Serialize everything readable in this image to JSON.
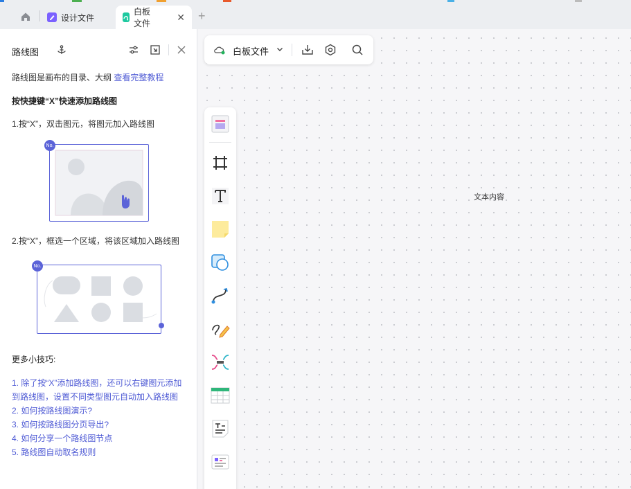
{
  "tabs": [
    {
      "label": "设计文件",
      "icon": "design-file-icon",
      "color": "#7b61ff"
    },
    {
      "label": "白板文件",
      "icon": "whiteboard-file-icon",
      "color": "#1ec9a0"
    }
  ],
  "panel": {
    "title": "路线图",
    "description": "路线图是画布的目录、大纲 ",
    "tutorial_link": "查看完整教程",
    "shortcut_title": "按快捷键“X”快速添加路线图",
    "step1": "1.按“X”，双击图元，将图元加入路线图",
    "step2": "2.按“X”，框选一个区域，将该区域加入路线图",
    "badge_label": "No.",
    "tips_title": "更多小技巧:",
    "tips": [
      "1. 除了按“X”添加路线图，还可以右键图元添加",
      "到路线图，设置不同类型图元自动加入路线图",
      "2. 如何按路线图演示?",
      "3. 如何按路线图分页导出?",
      "4. 如何分享一个路线图节点",
      "5. 路线图自动取名规则"
    ]
  },
  "topbar": {
    "title": "白板文件"
  },
  "canvas": {
    "text": "文本内容"
  },
  "colors": {
    "accent": "#5b63d8",
    "link": "#4f5bd5"
  }
}
